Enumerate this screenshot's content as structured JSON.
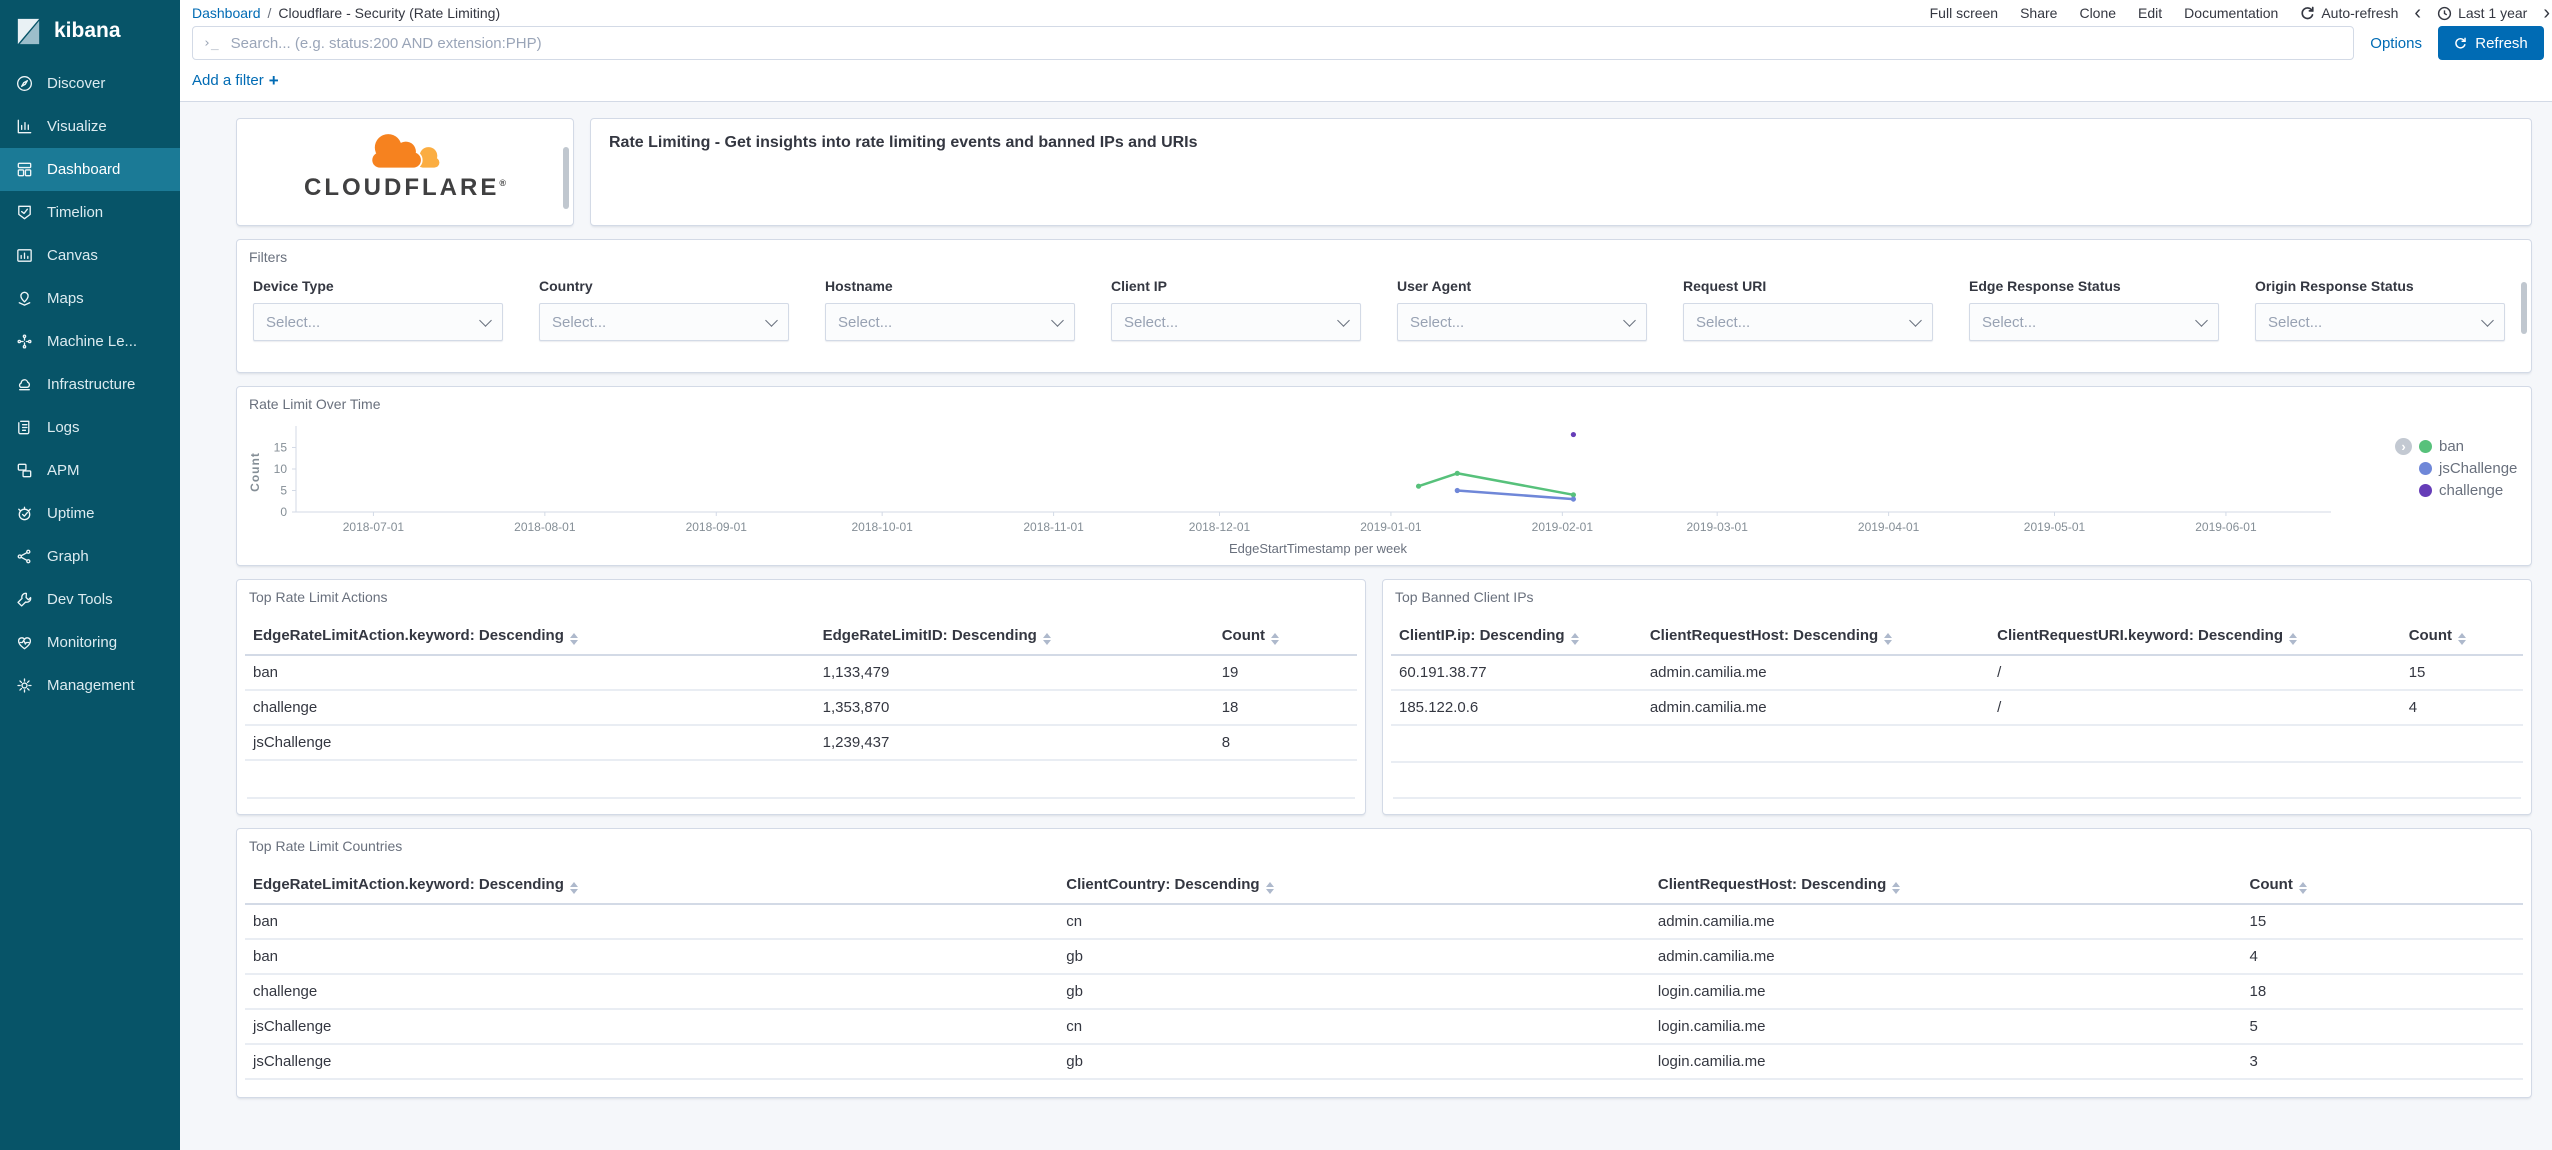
{
  "sidebar": {
    "logo_text": "kibana",
    "items": [
      {
        "id": "discover",
        "label": "Discover",
        "icon": "discover",
        "active": false
      },
      {
        "id": "visualize",
        "label": "Visualize",
        "icon": "visualize",
        "active": false
      },
      {
        "id": "dashboard",
        "label": "Dashboard",
        "icon": "dashboard",
        "active": true
      },
      {
        "id": "timelion",
        "label": "Timelion",
        "icon": "timelion",
        "active": false
      },
      {
        "id": "canvas",
        "label": "Canvas",
        "icon": "canvas",
        "active": false
      },
      {
        "id": "maps",
        "label": "Maps",
        "icon": "maps",
        "active": false
      },
      {
        "id": "machine-learning",
        "label": "Machine Le...",
        "icon": "ml",
        "active": false
      },
      {
        "id": "infrastructure",
        "label": "Infrastructure",
        "icon": "infrastructure",
        "active": false
      },
      {
        "id": "logs",
        "label": "Logs",
        "icon": "logs",
        "active": false
      },
      {
        "id": "apm",
        "label": "APM",
        "icon": "apm",
        "active": false
      },
      {
        "id": "uptime",
        "label": "Uptime",
        "icon": "uptime",
        "active": false
      },
      {
        "id": "graph",
        "label": "Graph",
        "icon": "graph",
        "active": false
      },
      {
        "id": "dev-tools",
        "label": "Dev Tools",
        "icon": "devtools",
        "active": false
      },
      {
        "id": "monitoring",
        "label": "Monitoring",
        "icon": "monitoring",
        "active": false
      },
      {
        "id": "management",
        "label": "Management",
        "icon": "management",
        "active": false
      }
    ]
  },
  "header": {
    "breadcrumb": {
      "root": "Dashboard",
      "sep": "/",
      "current": "Cloudflare - Security (Rate Limiting)"
    },
    "menu": [
      {
        "id": "full-screen",
        "label": "Full screen"
      },
      {
        "id": "share",
        "label": "Share"
      },
      {
        "id": "clone",
        "label": "Clone"
      },
      {
        "id": "edit",
        "label": "Edit"
      },
      {
        "id": "documentation",
        "label": "Documentation"
      }
    ],
    "auto_refresh_label": "Auto-refresh",
    "time_range_label": "Last 1 year"
  },
  "query_bar": {
    "placeholder": "Search... (e.g. status:200 AND extension:PHP)",
    "options_label": "Options",
    "refresh_label": "Refresh"
  },
  "filter_bar": {
    "add_filter_label": "Add a filter",
    "plus": "+"
  },
  "panels": {
    "branding": {
      "wordmark": "CLOUDFLARE",
      "registered": "®"
    },
    "description": {
      "text": "Rate Limiting - Get insights into rate limiting events and banned IPs and URIs"
    },
    "filters": {
      "title": "Filters",
      "fields": [
        {
          "label": "Device Type",
          "placeholder": "Select..."
        },
        {
          "label": "Country",
          "placeholder": "Select..."
        },
        {
          "label": "Hostname",
          "placeholder": "Select..."
        },
        {
          "label": "Client IP",
          "placeholder": "Select..."
        },
        {
          "label": "User Agent",
          "placeholder": "Select..."
        },
        {
          "label": "Request URI",
          "placeholder": "Select..."
        },
        {
          "label": "Edge Response Status",
          "placeholder": "Select..."
        },
        {
          "label": "Origin Response Status",
          "placeholder": "Select..."
        }
      ]
    },
    "actions_table": {
      "title": "Top Rate Limit Actions",
      "columns": [
        "EdgeRateLimitAction.keyword: Descending",
        "EdgeRateLimitID: Descending",
        "Count"
      ],
      "rows": [
        [
          "ban",
          "1,133,479",
          "19"
        ],
        [
          "challenge",
          "1,353,870",
          "18"
        ],
        [
          "jsChallenge",
          "1,239,437",
          "8"
        ]
      ]
    },
    "banned_ips_table": {
      "title": "Top Banned Client IPs",
      "columns": [
        "ClientIP.ip: Descending",
        "ClientRequestHost: Descending",
        "ClientRequestURI.keyword: Descending",
        "Count"
      ],
      "rows": [
        [
          "60.191.38.77",
          "admin.camilia.me",
          "/",
          "15"
        ],
        [
          "185.122.0.6",
          "admin.camilia.me",
          "/",
          "4"
        ]
      ]
    },
    "countries_table": {
      "title": "Top Rate Limit Countries",
      "columns": [
        "EdgeRateLimitAction.keyword: Descending",
        "ClientCountry: Descending",
        "ClientRequestHost: Descending",
        "Count"
      ],
      "rows": [
        [
          "ban",
          "cn",
          "admin.camilia.me",
          "15"
        ],
        [
          "ban",
          "gb",
          "admin.camilia.me",
          "4"
        ],
        [
          "challenge",
          "gb",
          "login.camilia.me",
          "18"
        ],
        [
          "jsChallenge",
          "cn",
          "login.camilia.me",
          "5"
        ],
        [
          "jsChallenge",
          "gb",
          "login.camilia.me",
          "3"
        ]
      ]
    }
  },
  "chart_data": {
    "type": "line",
    "title": "Rate Limit Over Time",
    "xlabel": "EdgeStartTimestamp per week",
    "ylabel": "Count",
    "ylim": [
      0,
      18.6
    ],
    "y_ticks": [
      0,
      5,
      10,
      15
    ],
    "x_ticks": [
      "2018-07-01",
      "2018-08-01",
      "2018-09-01",
      "2018-10-01",
      "2018-11-01",
      "2018-12-01",
      "2019-01-01",
      "2019-02-01",
      "2019-03-01",
      "2019-04-01",
      "2019-05-01",
      "2019-06-01"
    ],
    "x_range": [
      "2018-06-17",
      "2019-06-20"
    ],
    "grid": false,
    "legend_position": "right",
    "series": [
      {
        "name": "ban",
        "color": "#57c17b",
        "points": [
          [
            "2019-01-06",
            6
          ],
          [
            "2019-01-13",
            9
          ],
          [
            "2019-02-03",
            4
          ]
        ]
      },
      {
        "name": "jsChallenge",
        "color": "#6f87d8",
        "points": [
          [
            "2019-01-13",
            5
          ],
          [
            "2019-02-03",
            3
          ]
        ]
      },
      {
        "name": "challenge",
        "color": "#663db8",
        "points": [
          [
            "2019-02-03",
            18
          ]
        ]
      }
    ]
  }
}
